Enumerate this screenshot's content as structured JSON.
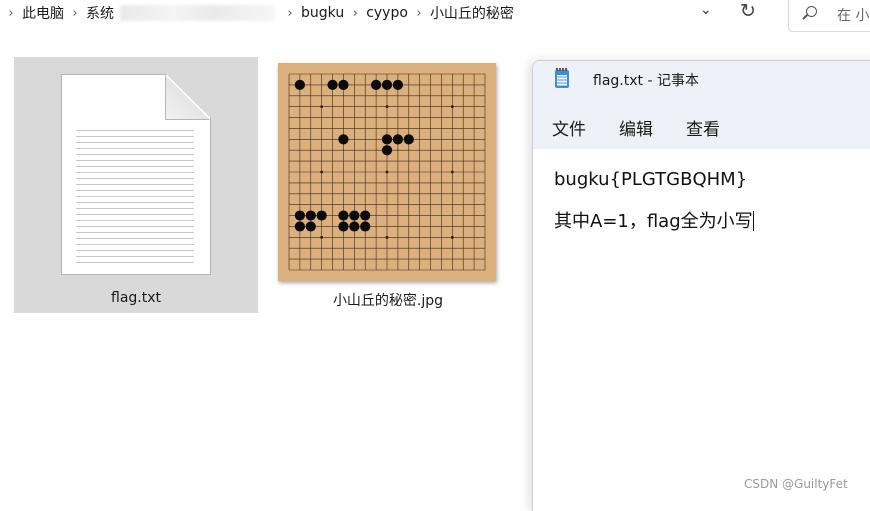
{
  "address_bar": {
    "crumbs": [
      "此电脑",
      "系统",
      "bugku",
      "cyypo",
      "小山丘的秘密"
    ],
    "search_placeholder": "在 小"
  },
  "files": [
    {
      "name": "flag.txt",
      "type": "text-document-icon",
      "selected": true
    },
    {
      "name": "小山丘的秘密.jpg",
      "type": "go-board-image",
      "selected": false
    }
  ],
  "go_board": {
    "grid_size": 19,
    "board_color": "#dcb07d",
    "stones": [
      [
        1,
        1
      ],
      [
        4,
        1
      ],
      [
        5,
        1
      ],
      [
        8,
        1
      ],
      [
        9,
        1
      ],
      [
        10,
        1
      ],
      [
        5,
        6
      ],
      [
        9,
        6
      ],
      [
        10,
        6
      ],
      [
        11,
        6
      ],
      [
        9,
        7
      ],
      [
        1,
        13
      ],
      [
        2,
        13
      ],
      [
        3,
        13
      ],
      [
        1,
        14
      ],
      [
        2,
        14
      ],
      [
        5,
        13
      ],
      [
        6,
        13
      ],
      [
        7,
        13
      ],
      [
        5,
        14
      ],
      [
        6,
        14
      ],
      [
        7,
        14
      ]
    ]
  },
  "notepad": {
    "title": "flag.txt - 记事本",
    "menu": [
      "文件",
      "编辑",
      "查看"
    ],
    "line1": "bugku{PLGTGBQHM}",
    "line2": "其中A=1，flag全为小写"
  },
  "watermark": "CSDN @GuiltyFet",
  "colors": {
    "selection": "#d9d9d9",
    "notepad_header": "#eef2f8",
    "notepad_icon": "#3a8fd6"
  }
}
